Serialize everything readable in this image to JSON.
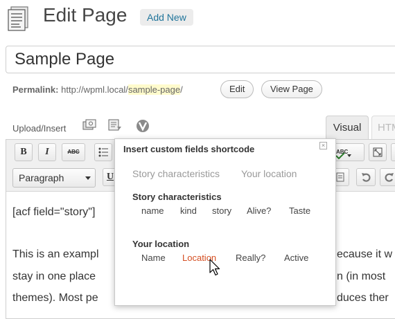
{
  "header": {
    "icon": "page-icon",
    "title": "Edit Page",
    "add_new": "Add New"
  },
  "title_field": {
    "value": "Sample Page"
  },
  "permalink": {
    "label": "Permalink:",
    "base": "http://wpml.local/",
    "slug": "sample-page",
    "trail": "/",
    "edit_button": "Edit",
    "view_button": "View Page"
  },
  "media": {
    "label": "Upload/Insert",
    "icons": [
      "add-media-icon",
      "insert-shortcode-icon",
      "v-logo-icon"
    ]
  },
  "editor_tabs": {
    "visual": "Visual",
    "html": "HTML"
  },
  "toolbar": {
    "bold": "B",
    "italic": "I",
    "strike": "ABC",
    "format_select": "Paragraph",
    "underline": "U",
    "spellcheck": "ABC",
    "icons": [
      "bullet-list-icon",
      "spellcheck-icon",
      "fullscreen-icon",
      "paste-text-icon",
      "undo-icon",
      "redo-icon"
    ]
  },
  "content": {
    "line1": "[acf field=\"story\"]",
    "line2_left": "This is an exampl",
    "line2_right": "ecause it w",
    "line3_left": "stay in one place",
    "line3_right": "n (in most",
    "line4_left": "themes). Most pe",
    "line4_right": "duces ther"
  },
  "popup": {
    "title": "Insert custom fields shortcode",
    "close_symbol": "×",
    "tabs": [
      "Story characteristics",
      "Your location"
    ],
    "groups": [
      {
        "title": "Story characteristics",
        "fields": [
          "name",
          "kind",
          "story",
          "Alive?",
          "Taste"
        ]
      },
      {
        "title": "Your location",
        "fields": [
          "Name",
          "Location",
          "Really?",
          "Active"
        ]
      }
    ],
    "hovered_field": "Location",
    "accent_color": "#d54e21"
  }
}
